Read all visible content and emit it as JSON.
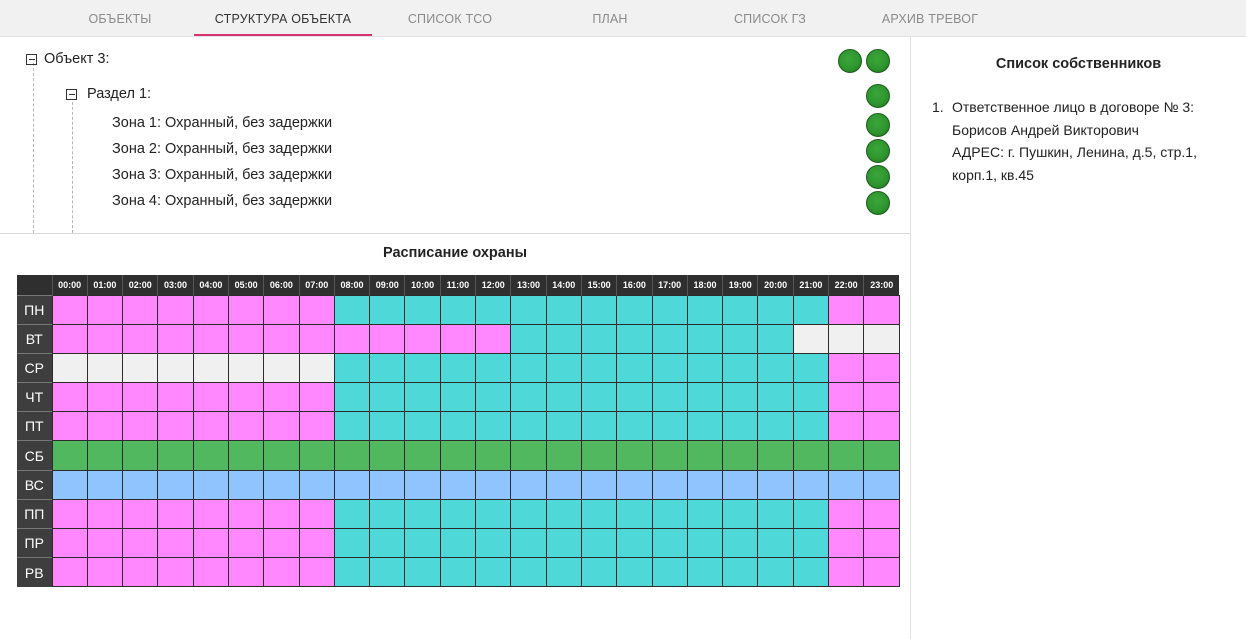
{
  "tabs": [
    {
      "label": "ОБЪЕКТЫ"
    },
    {
      "label": "СТРУКТУРА ОБЪЕКТА"
    },
    {
      "label": "СПИСОК ТСО"
    },
    {
      "label": "ПЛАН"
    },
    {
      "label": "СПИСОК ГЗ"
    },
    {
      "label": "АРХИВ ТРЕВОГ"
    }
  ],
  "active_tab": 1,
  "tree": {
    "object": {
      "label": "Объект 3:"
    },
    "section": {
      "label": "Раздел 1:"
    },
    "zones": [
      {
        "label": "Зона 1: Охранный, без задержки"
      },
      {
        "label": "Зона 2: Охранный, без задержки"
      },
      {
        "label": "Зона 3: Охранный, без задержки"
      },
      {
        "label": "Зона 4: Охранный, без задержки"
      }
    ],
    "status_color": "#2f962f"
  },
  "schedule": {
    "title": "Расписание охраны",
    "hours": [
      "00:00",
      "01:00",
      "02:00",
      "03:00",
      "04:00",
      "05:00",
      "06:00",
      "07:00",
      "08:00",
      "09:00",
      "10:00",
      "11:00",
      "12:00",
      "13:00",
      "14:00",
      "15:00",
      "16:00",
      "17:00",
      "18:00",
      "19:00",
      "20:00",
      "21:00",
      "22:00",
      "23:00"
    ],
    "colors": {
      "P": "#ff88ff",
      "T": "#4fd8d8",
      "W": "#f0f0f0",
      "G": "#52b85f",
      "B": "#90c4ff"
    },
    "rows": [
      {
        "day": "ПН",
        "cells": "PPPPPPPPTTTTTTTTTTTTTTPP"
      },
      {
        "day": "ВТ",
        "cells": "PPPPPPPPPPPPPTTTTTTTTWWW"
      },
      {
        "day": "СР",
        "cells": "WWWWWWWWTTTTTTTTTTTTTTPP"
      },
      {
        "day": "ЧТ",
        "cells": "PPPPPPPPTTTTTTTTTTTTTTPP"
      },
      {
        "day": "ПТ",
        "cells": "PPPPPPPPTTTTTTTTTTTTTTPP"
      },
      {
        "day": "СБ",
        "cells": "GGGGGGGGGGGGGGGGGGGGGGGG"
      },
      {
        "day": "ВС",
        "cells": "BBBBBBBBBBBBBBBBBBBBBBBB"
      },
      {
        "day": "ПП",
        "cells": "PPPPPPPPTTTTTTTTTTTTTTPP"
      },
      {
        "day": "ПР",
        "cells": "PPPPPPPPTTTTTTTTTTTTTTPP"
      },
      {
        "day": "РВ",
        "cells": "PPPPPPPPTTTTTTTTTTTTTTPP"
      }
    ]
  },
  "owners": {
    "title": "Список собственников",
    "items": [
      {
        "number": "1.",
        "line1": "Ответственное лицо в договоре № 3:",
        "line2": "Борисов Андрей Викторович",
        "line3": "АДРЕС: г. Пушкин, Ленина, д.5, стр.1,",
        "line4": "корп.1, кв.45"
      }
    ]
  }
}
